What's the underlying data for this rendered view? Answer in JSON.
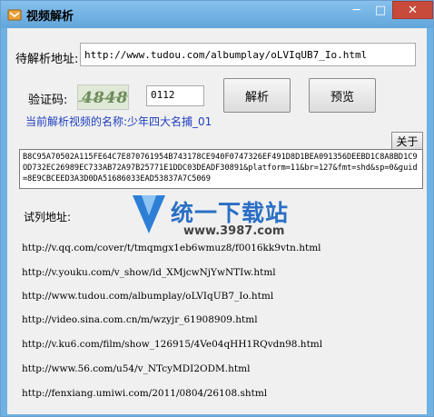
{
  "window": {
    "title": "视频解析",
    "minimize": "─",
    "maximize": "□",
    "close": "✕"
  },
  "form": {
    "url_label": "待解析地址:",
    "url_value": "http://www.tudou.com/albumplay/oLVIqUB7_Io.html",
    "captcha_label": "验证码:",
    "captcha_text": "4848",
    "captcha_value": "0112",
    "parse_button": "解析",
    "preview_button": "预览",
    "current_label": "当前解析视频的名称:",
    "current_value": "少年四大名捕_01",
    "about_button": "关于"
  },
  "result_text": "B8C95A70502A115FE64C7E870761954B743178CE940F0747326EF491D8D1BEA091356DEEBD1C8A8BD1C9OD732EC26989EC733AB72A97B25771E1DDC03DEADF30891&platform=11&br=127&fmt=shd&sp=0&guid=8E9CBCEED3A3D0DA51686033EAD53837A7C5069",
  "examples": {
    "label": "试列地址:",
    "items": [
      "http://v.qq.com/cover/t/tmqmgx1eb6wmuz8/f0016kk9vtn.html",
      "http://v.youku.com/v_show/id_XMjcwNjYwNTIw.html",
      "http://www.tudou.com/albumplay/oLVIqUB7_Io.html",
      "http://video.sina.com.cn/m/wzyjr_61908909.html",
      "http://v.ku6.com/film/show_126915/4Ve04qHH1RQvdn98.html",
      "http://www.56.com/u54/v_NTcyMDI2ODM.html",
      "http://fenxiang.umiwi.com/2011/0804/26108.shtml"
    ]
  },
  "watermark": {
    "text": "统一下载站",
    "url": "www.3987.com"
  },
  "colors": {
    "titlebar": "#6fb1e3",
    "close": "#c74a3a",
    "link_blue": "#1f3fbf",
    "watermark_blue": "#2a6fc5"
  }
}
